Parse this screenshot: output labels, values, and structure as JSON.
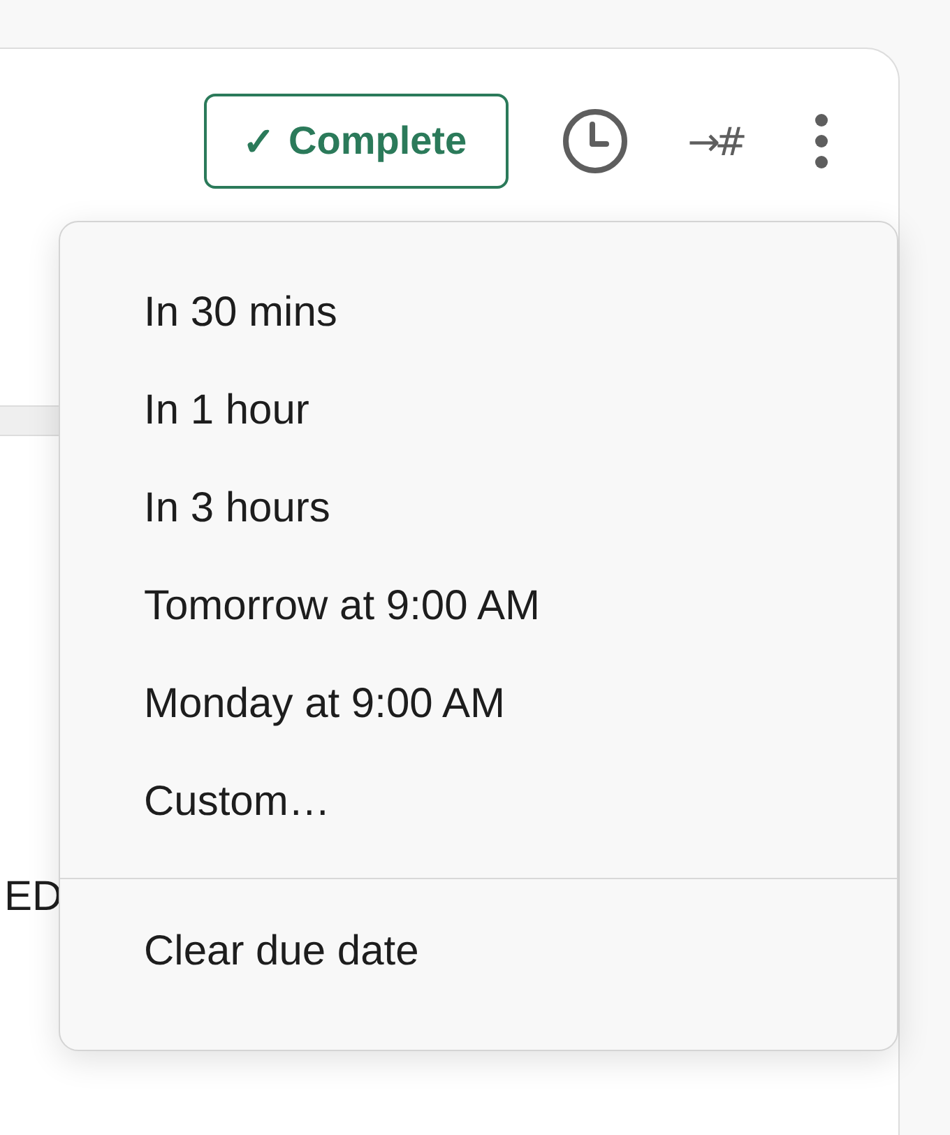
{
  "toolbar": {
    "complete_button": {
      "check": "✓",
      "label": "Complete"
    },
    "move_icon_text": "→#"
  },
  "background_text": "ED",
  "menu": {
    "items": [
      {
        "label": "In 30 mins"
      },
      {
        "label": "In 1 hour"
      },
      {
        "label": "In 3 hours"
      },
      {
        "label": "Tomorrow at 9:00 AM"
      },
      {
        "label": "Monday at 9:00 AM"
      },
      {
        "label": "Custom…"
      }
    ],
    "footer_items": [
      {
        "label": "Clear due date"
      }
    ]
  }
}
